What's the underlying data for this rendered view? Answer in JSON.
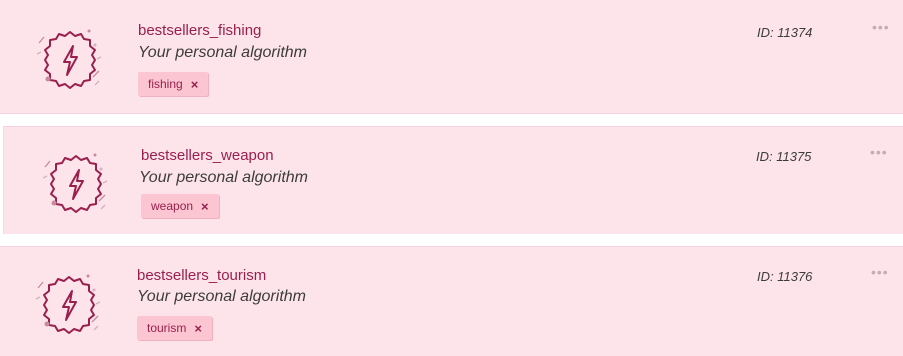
{
  "colors": {
    "card_background": "#fde4ea",
    "accent": "#9a1f4d",
    "tag_background": "#fbc6d2",
    "text": "#3c3c3c"
  },
  "cards": [
    {
      "title": "bestsellers_fishing",
      "subtitle": "Your personal algorithm",
      "tag": "fishing",
      "tag_remove_glyph": "×",
      "id": "ID: 11374",
      "more_glyph": "•••",
      "icon": "lightning-badge-icon"
    },
    {
      "title": "bestsellers_weapon",
      "subtitle": "Your personal algorithm",
      "tag": "weapon",
      "tag_remove_glyph": "×",
      "id": "ID: 11375",
      "more_glyph": "•••",
      "icon": "lightning-badge-icon"
    },
    {
      "title": "bestsellers_tourism",
      "subtitle": "Your personal algorithm",
      "tag": "tourism",
      "tag_remove_glyph": "×",
      "id": "ID: 11376",
      "more_glyph": "•••",
      "icon": "lightning-badge-icon"
    }
  ]
}
